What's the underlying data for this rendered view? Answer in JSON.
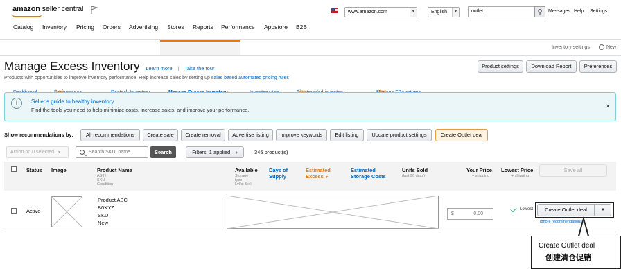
{
  "header": {
    "logo_brand": "amazon",
    "logo_sub": "seller central",
    "marketplace": "www.amazon.com",
    "language": "English",
    "search_value": "outlet",
    "links": [
      "Messages",
      "Help",
      "Settings"
    ]
  },
  "main_nav": [
    "Catalog",
    "Inventory",
    "Pricing",
    "Orders",
    "Advertising",
    "Stores",
    "Reports",
    "Performance",
    "Appstore",
    "B2B"
  ],
  "sub_nav": {
    "tabs": [
      {
        "label": "Dashboard",
        "badge": ""
      },
      {
        "label": "Performance",
        "badge": "New"
      },
      {
        "label": "Restock Inventory",
        "badge": ""
      },
      {
        "label": "Manage Excess Inventory",
        "badge": ""
      },
      {
        "label": "Inventory Age",
        "badge": ""
      },
      {
        "label": "Fix stranded inventory",
        "badge": "New"
      },
      {
        "label": "Manage FBA returns",
        "badge": "New"
      }
    ],
    "settings_label": "Inventory settings",
    "settings_badge": "New"
  },
  "page": {
    "title": "Manage Excess Inventory",
    "learn_more": "Learn more",
    "separator": "|",
    "take_tour": "Take the tour",
    "description_prefix": "Products with opportunities to improve inventory performance. Help increase sales by setting up",
    "description_link": "sales based automated pricing rules",
    "buttons": [
      "Product settings",
      "Download Report",
      "Preferences"
    ]
  },
  "banner": {
    "icon": "i",
    "title": "Seller's guide to healthy inventory",
    "text": "Find the tools you need to help minimize costs, increase sales, and improve your performance.",
    "close": "×"
  },
  "recommendations": {
    "label": "Show recommendations by:",
    "buttons": [
      "All recommendations",
      "Create sale",
      "Create removal",
      "Advertise listing",
      "Improve keywords",
      "Edit listing",
      "Update product settings",
      "Create Outlet deal"
    ]
  },
  "toolbar": {
    "action_select": "Action on 0 selected",
    "search_placeholder": "Search SKU, name",
    "search_button": "Search",
    "filter_label": "Filters: 1 applied",
    "count": "345 product(s)"
  },
  "table": {
    "headers": {
      "status": "Status",
      "image": "Image",
      "product_name": "Product Name",
      "product_sub": [
        "ASIN",
        "SKU",
        "Condition"
      ],
      "available": "Available",
      "available_sub": [
        "Storage",
        "type",
        "Lvl/s: Sell"
      ],
      "days_supply": "Days of Supply",
      "excess": "Estimated Excess",
      "storage": "Estimated Storage Costs",
      "units_sold": "Units Sold",
      "units_sub": "(last 90 days)",
      "your_price": "Your Price",
      "your_price_sub": "+ shipping",
      "lowest_price": "Lowest Price",
      "lowest_price_sub": "+ shipping",
      "save_all": "Save all"
    },
    "rows": [
      {
        "status": "Active",
        "name": "Product ABC",
        "asin": "B0XYZ",
        "sku": "SKU",
        "condition": "New",
        "price_symbol": "$",
        "price": "0.00",
        "lowest": "Lowest",
        "action": "Create Outlet deal",
        "ignore": "Ignore recommendations"
      }
    ]
  },
  "callout": {
    "en": "Create Outlet deal",
    "zh": "创建清仓促销"
  },
  "colors": {
    "accent": "#e47911",
    "link": "#0066c0",
    "banner_bg": "#eaf6f7"
  }
}
